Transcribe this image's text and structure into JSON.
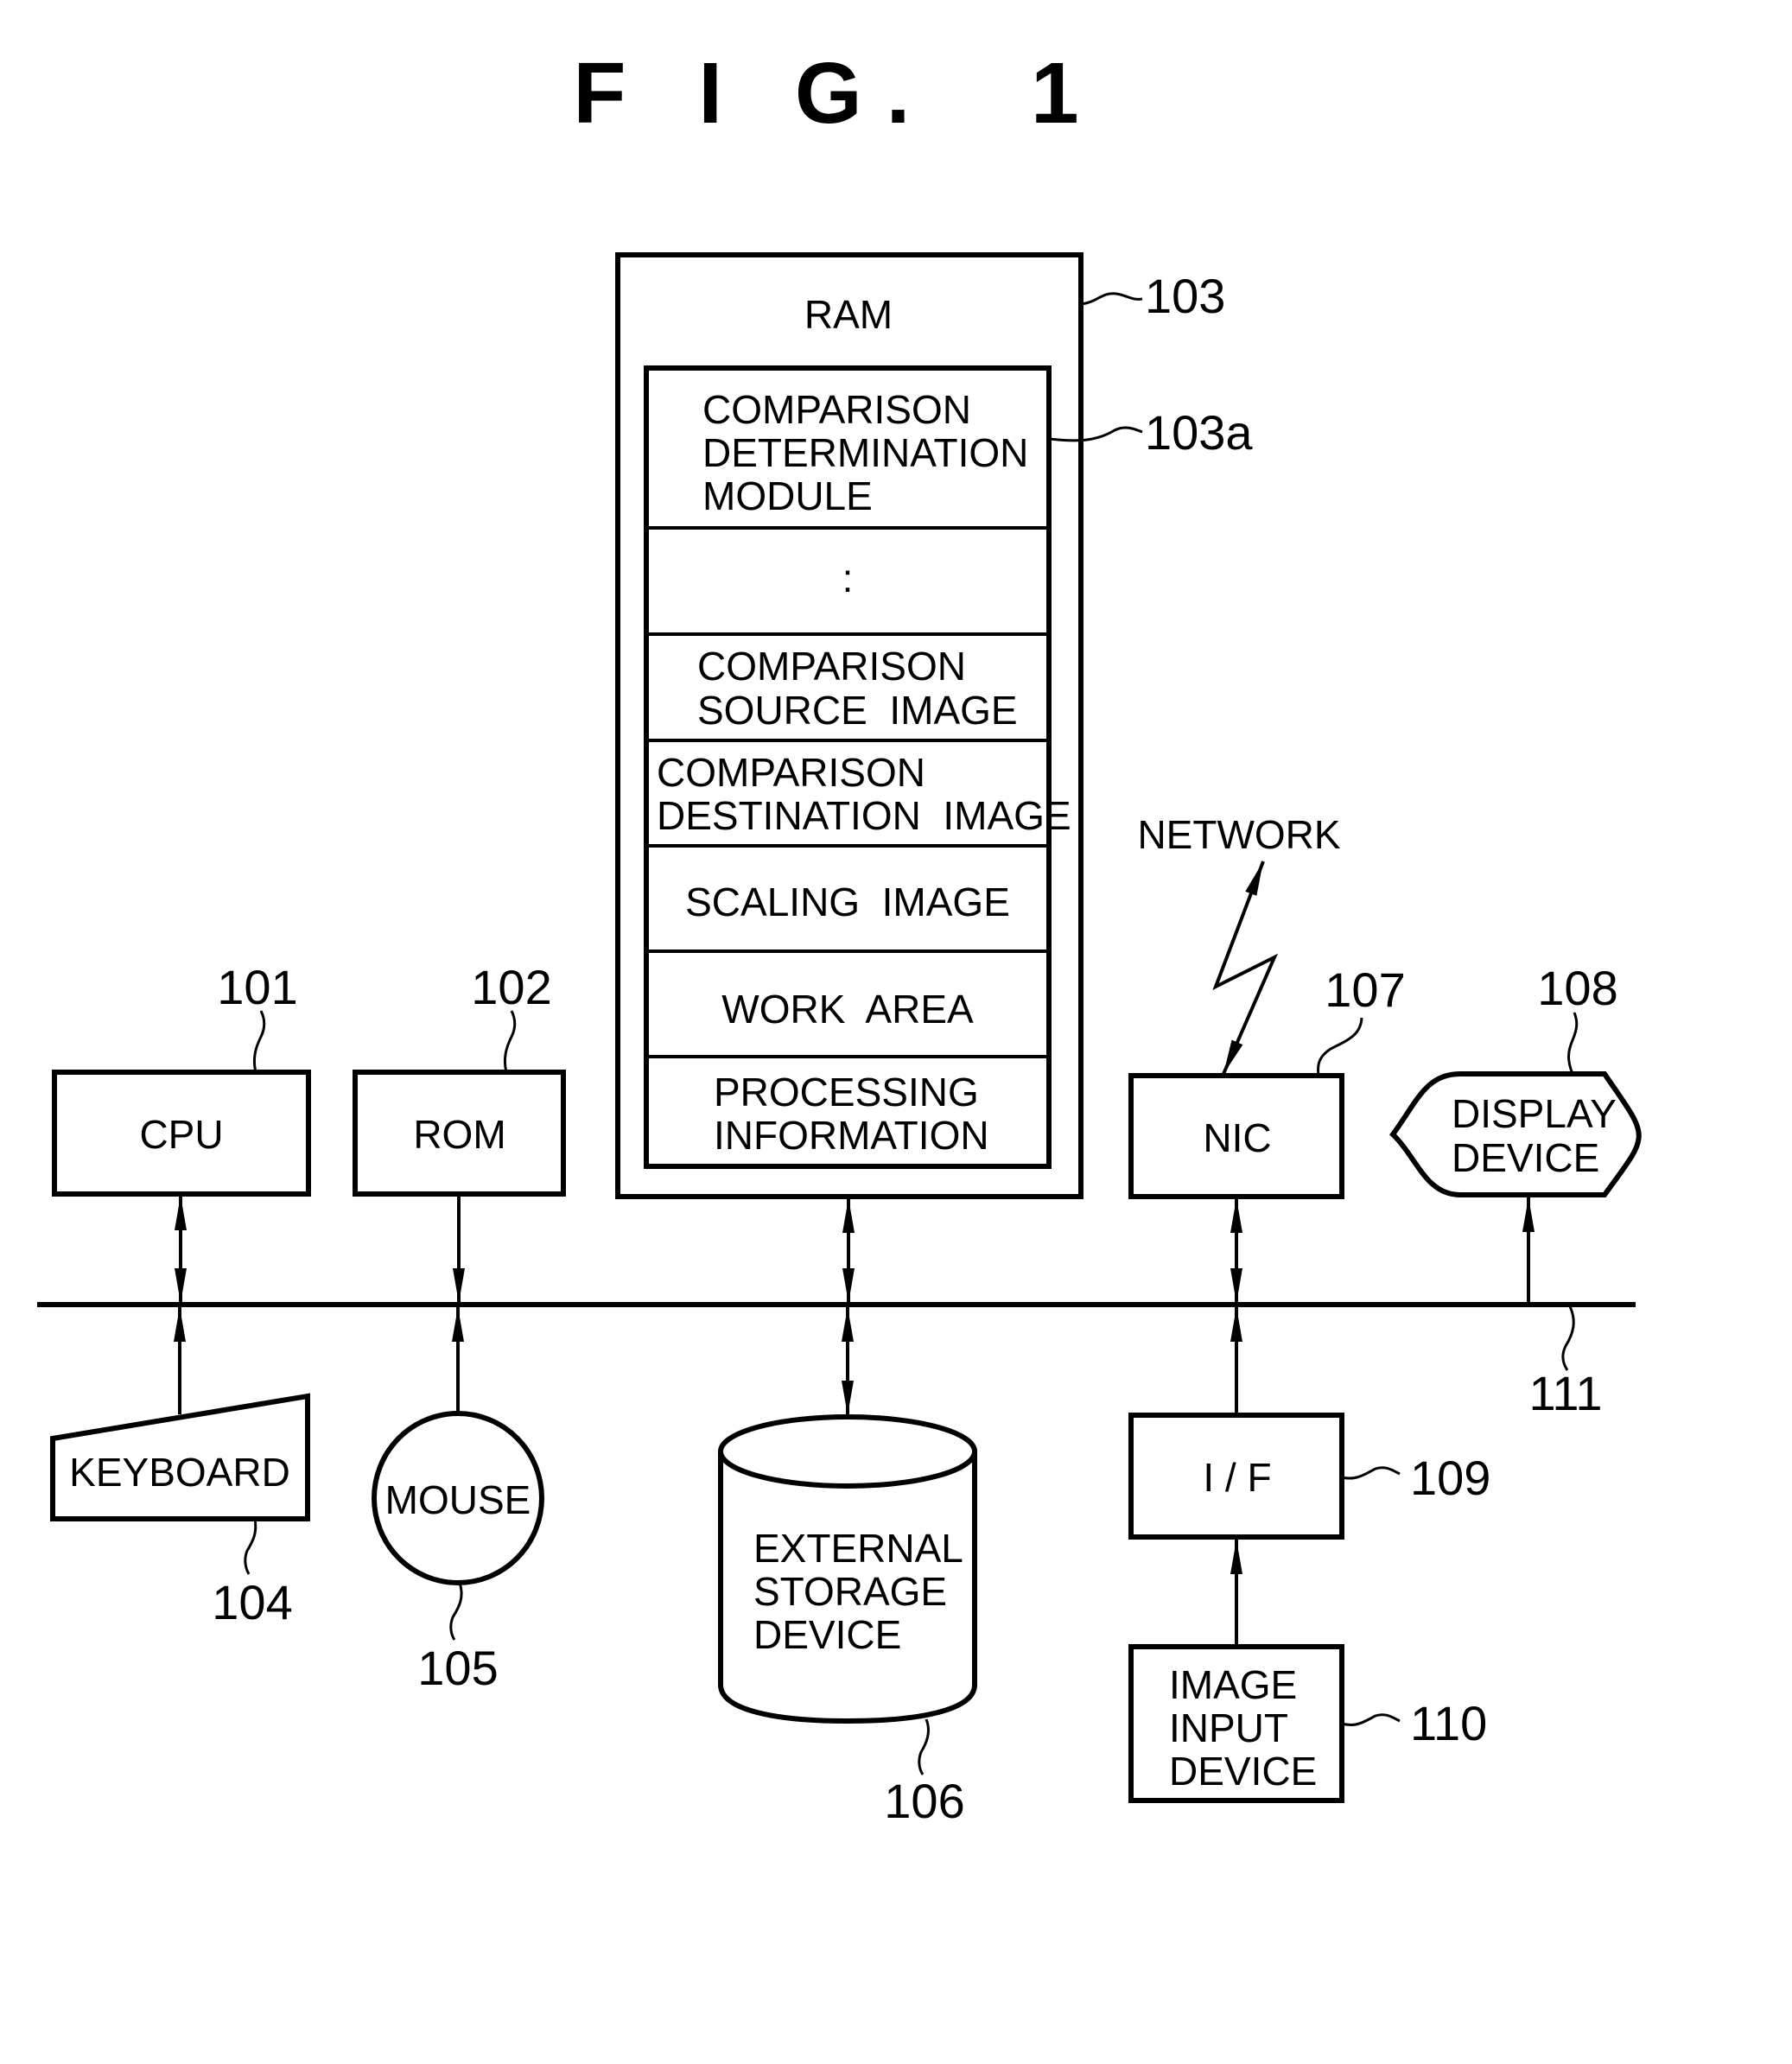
{
  "figure": {
    "title": "F I G.  1"
  },
  "ram": {
    "label": "RAM",
    "ref": "103",
    "inner_ref": "103a",
    "rows": [
      {
        "lines": [
          "COMPARISON",
          "DETERMINATION",
          "MODULE"
        ]
      },
      {
        "lines": [
          ":"
        ]
      },
      {
        "lines": [
          "COMPARISON",
          "SOURCE  IMAGE"
        ]
      },
      {
        "lines": [
          "COMPARISON",
          "DESTINATION  IMAGE"
        ]
      },
      {
        "lines": [
          "SCALING  IMAGE"
        ]
      },
      {
        "lines": [
          "WORK  AREA"
        ]
      },
      {
        "lines": [
          "PROCESSING",
          "INFORMATION"
        ]
      }
    ]
  },
  "components": {
    "cpu": {
      "label": "CPU",
      "ref": "101"
    },
    "rom": {
      "label": "ROM",
      "ref": "102"
    },
    "keyboard": {
      "label": "KEYBOARD",
      "ref": "104"
    },
    "mouse": {
      "label": "MOUSE",
      "ref": "105"
    },
    "storage": {
      "lines": [
        "EXTERNAL",
        "STORAGE",
        "DEVICE"
      ],
      "ref": "106"
    },
    "nic": {
      "label": "NIC",
      "ref": "107"
    },
    "display": {
      "lines": [
        "DISPLAY",
        "DEVICE"
      ],
      "ref": "108"
    },
    "interface": {
      "label": "I / F",
      "ref": "109"
    },
    "image_input": {
      "lines": [
        "IMAGE",
        "INPUT",
        "DEVICE"
      ],
      "ref": "110"
    },
    "bus": {
      "ref": "111"
    },
    "network": {
      "label": "NETWORK"
    }
  }
}
